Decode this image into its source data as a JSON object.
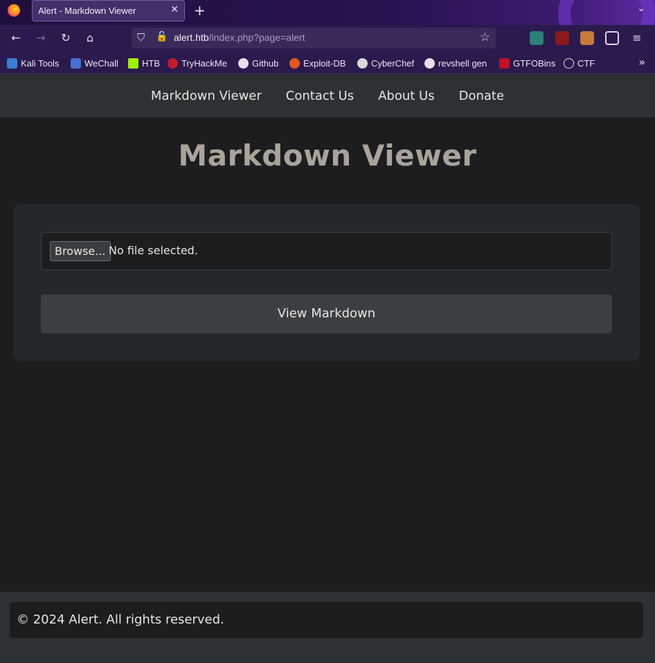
{
  "browser": {
    "tab_title": "Alert - Markdown Viewer",
    "url_host": "alert.htb",
    "url_path": "/index.php?page=alert",
    "bookmarks": [
      {
        "label": "Kali Tools",
        "icon": "kali-icon",
        "color": "#3b7fd6"
      },
      {
        "label": "WeChall",
        "icon": "wechall-icon",
        "color": "#4a6fd0"
      },
      {
        "label": "HTB",
        "icon": "htb-icon",
        "color": "#9fef00"
      },
      {
        "label": "TryHackMe",
        "icon": "tryhackme-icon",
        "color": "#c11b2f"
      },
      {
        "label": "Github",
        "icon": "github-icon",
        "color": "#e6e0f2"
      },
      {
        "label": "Exploit-DB",
        "icon": "exploitdb-icon",
        "color": "#e05a1c"
      },
      {
        "label": "CyberChef",
        "icon": "cyberchef-icon",
        "color": "#d8d8d8"
      },
      {
        "label": "revshell gen",
        "icon": "skull-icon",
        "color": "#e6e0f2"
      },
      {
        "label": "GTFOBins",
        "icon": "gtfobins-icon",
        "color": "#c0102a"
      },
      {
        "label": "CTF",
        "icon": "globe-icon",
        "color": "#e6e0f2"
      }
    ]
  },
  "site": {
    "nav": [
      "Markdown Viewer",
      "Contact Us",
      "About Us",
      "Donate"
    ],
    "title": "Markdown Viewer",
    "file_button": "Browse...",
    "file_status": "No file selected.",
    "submit_label": "View Markdown",
    "footer": "© 2024 Alert. All rights reserved."
  }
}
